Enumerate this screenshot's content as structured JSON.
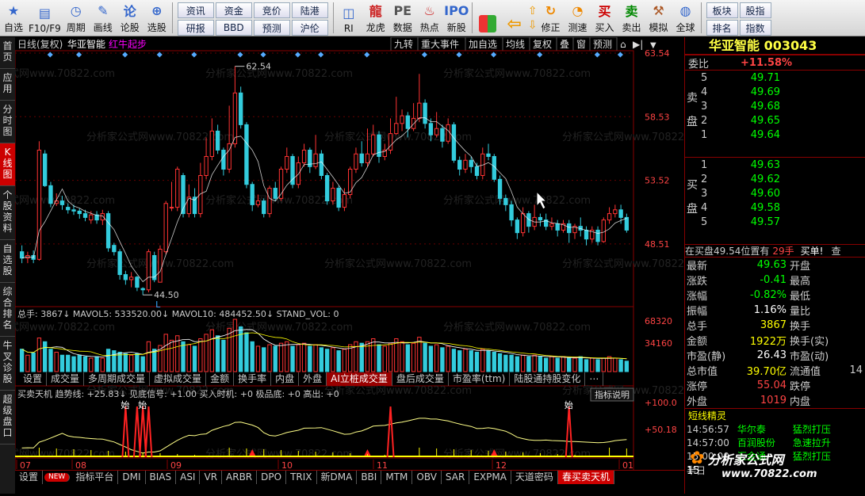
{
  "toolbar": {
    "buttons_left": [
      {
        "label": "自选",
        "icon": "star-icon"
      },
      {
        "label": "F10/F9",
        "icon": "f10-icon"
      },
      {
        "label": "周期",
        "icon": "clock-icon"
      },
      {
        "label": "画线",
        "icon": "pencil-icon"
      },
      {
        "label": "论股",
        "icon": "chat-icon"
      },
      {
        "label": "选股",
        "icon": "chart-select-icon"
      }
    ],
    "grid_buttons": [
      "资讯",
      "资金",
      "竞价",
      "陆港",
      "研报",
      "BBD",
      "预测",
      "沪伦"
    ],
    "buttons_mid": [
      {
        "label": "RI",
        "icon": "ri-icon"
      },
      {
        "label": "龙虎",
        "icon": "dragon-icon"
      },
      {
        "label": "数据",
        "icon": "pe-icon"
      },
      {
        "label": "热点",
        "icon": "hot-icon"
      },
      {
        "label": "新股",
        "icon": "ipo-icon"
      }
    ],
    "buttons_right": [
      {
        "label": "修正",
        "icon": "refresh-icon"
      },
      {
        "label": "测速",
        "icon": "speed-icon"
      },
      {
        "label": "买入",
        "icon": "buy-icon"
      },
      {
        "label": "卖出",
        "icon": "sell-icon"
      },
      {
        "label": "模拟",
        "icon": "hammer-icon"
      },
      {
        "label": "全球",
        "icon": "globe-icon"
      }
    ],
    "grid2_buttons": [
      "板块",
      "股指",
      "排名",
      "指数"
    ]
  },
  "left_tabs": [
    "首页",
    "应用",
    "分时图",
    "K线图",
    "个股资料",
    "自选股",
    "综合排名",
    "牛叉诊股",
    "超级盘口"
  ],
  "left_tabs_active": 3,
  "chart_header": {
    "period": "日线(复权)",
    "stock": "华亚智能",
    "signal": "红牛起步"
  },
  "chart_controls": [
    "九转",
    "重大事件",
    "加自选",
    "均线",
    "复权",
    "叠",
    "窗",
    "预测"
  ],
  "chart_data": {
    "type": "candlestick",
    "y_ticks": [
      "63.54",
      "58.53",
      "53.52",
      "48.51"
    ],
    "annotations": [
      "62.54",
      "44.50"
    ],
    "x_labels": [
      "07",
      "08",
      "09",
      "10",
      "11",
      "12",
      "01"
    ],
    "volume_labels": [
      "68320",
      "34160"
    ],
    "volume_title": "总手: 3867↓ MAVOL5: 533520.00↓ MAVOL10: 484452.50↓ STAND_VOL: 0",
    "indicator_title": "买卖天机 趋势线: +25.83↓ 见底信号: +1.00 买入时机: +0 极品底: +0 高出: +0",
    "indicator_ticks": [
      "+100.0",
      "+50.18"
    ],
    "indicator_button": "指标说明",
    "signal_text": "始",
    "candles": [
      [
        47.9,
        47.4,
        48.4,
        47.0
      ],
      [
        47.4,
        47.6,
        47.9,
        47.0
      ],
      [
        47.6,
        47.3,
        48.0,
        47.0
      ],
      [
        47.3,
        55.9,
        56.6,
        47.2
      ],
      [
        55.6,
        53.1,
        55.9,
        53.0
      ],
      [
        53.1,
        51.7,
        53.4,
        51.4
      ],
      [
        51.7,
        51.9,
        52.5,
        51.5
      ],
      [
        51.9,
        51.6,
        52.3,
        51.2
      ],
      [
        51.4,
        51.2,
        51.7,
        50.9
      ],
      [
        51.2,
        51.1,
        51.6,
        50.8
      ],
      [
        51.1,
        50.9,
        51.3,
        50.5
      ],
      [
        50.9,
        50.6,
        51.2,
        50.3
      ],
      [
        50.4,
        50.8,
        51.1,
        50.1
      ],
      [
        50.8,
        50.4,
        51.1,
        50.1
      ],
      [
        50.4,
        50.9,
        51.2,
        50.0
      ],
      [
        50.9,
        48.2,
        51.1,
        47.9
      ],
      [
        48.4,
        47.9,
        48.6,
        47.6
      ],
      [
        47.9,
        46.1,
        48.1,
        45.7
      ],
      [
        46.1,
        45.7,
        46.4,
        45.3
      ],
      [
        45.7,
        45.9,
        46.3,
        45.1
      ],
      [
        45.9,
        45.1,
        46.0,
        44.8
      ],
      [
        45.0,
        44.9,
        45.1,
        44.5
      ],
      [
        44.9,
        47.9,
        48.1,
        44.7
      ],
      [
        47.6,
        45.7,
        47.9,
        45.5
      ],
      [
        45.5,
        48.1,
        48.4,
        45.5
      ],
      [
        47.9,
        51.7,
        51.9,
        47.7
      ],
      [
        51.4,
        51.4,
        53.4,
        51.1
      ],
      [
        51.4,
        54.4,
        54.6,
        51.1
      ],
      [
        53.9,
        50.9,
        54.1,
        50.6
      ],
      [
        50.9,
        52.2,
        53.2,
        50.6
      ],
      [
        52.2,
        50.9,
        52.9,
        50.6
      ],
      [
        50.9,
        53.9,
        54.9,
        50.6
      ],
      [
        53.9,
        55.4,
        56.9,
        53.6
      ],
      [
        55.4,
        57.4,
        58.4,
        55.1
      ],
      [
        57.4,
        55.9,
        57.9,
        55.6
      ],
      [
        55.9,
        54.4,
        56.1,
        53.9
      ],
      [
        54.4,
        56.4,
        59.4,
        54.1
      ],
      [
        56.4,
        60.4,
        62.5,
        56.1
      ],
      [
        60.4,
        57.9,
        60.9,
        57.6
      ],
      [
        57.9,
        53.2,
        58.1,
        52.9
      ],
      [
        53.2,
        51.6,
        53.4,
        51.1
      ],
      [
        51.6,
        51.9,
        52.4,
        51.4
      ],
      [
        51.9,
        50.9,
        52.1,
        50.6
      ],
      [
        50.9,
        52.9,
        53.1,
        50.6
      ],
      [
        52.9,
        52.1,
        53.4,
        51.9
      ],
      [
        52.1,
        54.4,
        54.6,
        51.9
      ],
      [
        54.4,
        55.4,
        56.1,
        54.1
      ],
      [
        55.4,
        53.2,
        55.6,
        52.9
      ],
      [
        53.2,
        54.9,
        55.4,
        52.9
      ],
      [
        54.9,
        55.9,
        56.4,
        54.6
      ],
      [
        55.9,
        54.6,
        56.1,
        54.1
      ],
      [
        54.6,
        55.6,
        57.1,
        54.4
      ],
      [
        55.6,
        53.9,
        55.9,
        53.6
      ],
      [
        53.9,
        51.9,
        54.1,
        51.6
      ],
      [
        51.9,
        52.9,
        53.4,
        51.6
      ],
      [
        52.9,
        51.4,
        53.1,
        51.1
      ],
      [
        51.4,
        52.4,
        52.9,
        51.1
      ],
      [
        52.4,
        54.4,
        54.6,
        52.1
      ],
      [
        54.4,
        55.6,
        56.1,
        54.1
      ],
      [
        55.6,
        54.9,
        56.6,
        54.6
      ],
      [
        54.9,
        55.6,
        57.6,
        54.6
      ],
      [
        55.6,
        57.1,
        57.9,
        55.4
      ],
      [
        57.1,
        55.4,
        57.4,
        54.9
      ],
      [
        55.4,
        55.9,
        56.4,
        55.1
      ],
      [
        55.9,
        57.2,
        58.4,
        55.6
      ],
      [
        57.2,
        58.0,
        60.1,
        57.1
      ],
      [
        58.0,
        58.6,
        59.1,
        57.4
      ],
      [
        58.6,
        57.6,
        58.9,
        56.9
      ],
      [
        57.6,
        58.4,
        59.6,
        57.4
      ],
      [
        58.4,
        59.6,
        61.9,
        58.1
      ],
      [
        59.6,
        58.0,
        59.9,
        57.6
      ],
      [
        58.0,
        57.1,
        58.4,
        56.6
      ],
      [
        57.1,
        57.6,
        58.9,
        56.9
      ],
      [
        57.6,
        56.6,
        57.9,
        56.1
      ],
      [
        56.6,
        57.9,
        58.4,
        56.4
      ],
      [
        57.9,
        55.1,
        58.1,
        54.9
      ],
      [
        55.1,
        54.4,
        55.4,
        53.9
      ],
      [
        54.4,
        55.1,
        55.6,
        54.1
      ],
      [
        55.1,
        54.6,
        55.4,
        54.1
      ],
      [
        54.6,
        53.9,
        54.9,
        53.6
      ],
      [
        53.9,
        55.6,
        56.1,
        53.6
      ],
      [
        55.6,
        55.4,
        56.4,
        55.1
      ],
      [
        55.4,
        53.6,
        55.6,
        53.4
      ],
      [
        53.6,
        52.1,
        53.9,
        51.6
      ],
      [
        52.1,
        51.6,
        52.4,
        51.1
      ],
      [
        51.6,
        50.4,
        51.9,
        49.9
      ],
      [
        50.4,
        49.4,
        50.6,
        48.9
      ],
      [
        49.4,
        50.9,
        51.4,
        49.1
      ],
      [
        50.9,
        49.9,
        51.1,
        49.4
      ],
      [
        49.9,
        50.6,
        51.6,
        49.6
      ],
      [
        50.6,
        50.4,
        50.9,
        49.9
      ],
      [
        50.4,
        49.9,
        50.9,
        49.6
      ],
      [
        49.9,
        50.1,
        50.6,
        49.6
      ],
      [
        50.1,
        49.6,
        50.4,
        49.1
      ],
      [
        49.6,
        50.1,
        50.4,
        49.4
      ],
      [
        50.1,
        49.4,
        50.4,
        48.6
      ],
      [
        49.4,
        49.9,
        50.1,
        48.9
      ],
      [
        49.9,
        49.6,
        50.6,
        49.1
      ],
      [
        49.6,
        48.9,
        49.9,
        48.4
      ],
      [
        48.9,
        49.6,
        49.9,
        48.6
      ],
      [
        49.6,
        48.7,
        49.9,
        48.4
      ],
      [
        48.7,
        50.4,
        50.6,
        48.6
      ],
      [
        50.4,
        50.9,
        51.4,
        50.1
      ],
      [
        50.9,
        51.2,
        51.6,
        50.6
      ],
      [
        51.2,
        50.6,
        51.6,
        50.1
      ],
      [
        50.6,
        49.6,
        50.9,
        49.4
      ]
    ],
    "volumes": [
      30,
      22,
      25,
      45,
      40,
      30,
      26,
      22,
      22,
      20,
      22,
      20,
      18,
      20,
      18,
      30,
      28,
      26,
      24,
      22,
      24,
      20,
      40,
      30,
      35,
      50,
      42,
      48,
      40,
      36,
      34,
      44,
      50,
      56,
      48,
      42,
      58,
      70,
      60,
      52,
      40,
      34,
      32,
      36,
      34,
      38,
      40,
      34,
      36,
      38,
      34,
      36,
      32,
      30,
      32,
      28,
      30,
      36,
      40,
      38,
      40,
      44,
      36,
      34,
      38,
      44,
      40,
      36,
      38,
      46,
      38,
      34,
      36,
      32,
      34,
      30,
      28,
      30,
      28,
      26,
      30,
      28,
      26,
      24,
      22,
      22,
      20,
      22,
      20,
      22,
      20,
      18,
      20,
      18,
      20,
      18,
      18,
      20,
      16,
      18,
      16,
      18,
      20,
      18,
      16,
      14
    ]
  },
  "mid_tabs": [
    "设置",
    "成交量",
    "多周期成交量",
    "虚拟成交量",
    "金额",
    "换手率",
    "内盘",
    "外盘",
    "AI立桩成交量",
    "盘后成交量",
    "市盈率(ttm)",
    "陆股通持股变化",
    "⋯"
  ],
  "mid_tabs_active": 8,
  "bottom_tabs": [
    "设置",
    "NEW",
    "指标平台",
    "DMI",
    "BIAS",
    "ASI",
    "VR",
    "ARBR",
    "DPO",
    "TRIX",
    "新DMA",
    "BBI",
    "MTM",
    "OBV",
    "SAR",
    "EXPMA",
    "天道密码",
    "春买卖天机"
  ],
  "bottom_tabs_active": 17,
  "right": {
    "title": "华亚智能 003043",
    "weibi_label": "委比",
    "weibi_value": "+11.58%",
    "sell_label": "卖盘",
    "buy_label": "买盘",
    "sells": [
      {
        "n": "5",
        "p": "49.71"
      },
      {
        "n": "4",
        "p": "49.69"
      },
      {
        "n": "3",
        "p": "49.68"
      },
      {
        "n": "2",
        "p": "49.65"
      },
      {
        "n": "1",
        "p": "49.64"
      }
    ],
    "buys": [
      {
        "n": "1",
        "p": "49.63"
      },
      {
        "n": "2",
        "p": "49.62"
      },
      {
        "n": "3",
        "p": "49.60"
      },
      {
        "n": "4",
        "p": "49.58"
      },
      {
        "n": "5",
        "p": "49.57"
      }
    ],
    "notice": "在买盘49.54位置有",
    "notice_qty": "29手",
    "notice_action": "买单!",
    "notice_more": "查",
    "quotes": [
      {
        "k": "最新",
        "v": "49.63",
        "c": "#0f0",
        "k2": "开盘",
        "v2": ""
      },
      {
        "k": "涨跌",
        "v": "-0.41",
        "c": "#0f0",
        "k2": "最高",
        "v2": ""
      },
      {
        "k": "涨幅",
        "v": "-0.82%",
        "c": "#0f0",
        "k2": "最低",
        "v2": ""
      },
      {
        "k": "振幅",
        "v": "1.16%",
        "c": "#fff",
        "k2": "量比",
        "v2": ""
      },
      {
        "k": "总手",
        "v": "3867",
        "c": "#ff0",
        "k2": "换手",
        "v2": ""
      },
      {
        "k": "金额",
        "v": "1922万",
        "c": "#ff0",
        "k2": "换手(实)",
        "v2": ""
      },
      {
        "k": "市盈(静)",
        "v": "26.43",
        "c": "#fff",
        "k2": "市盈(动)",
        "v2": ""
      },
      {
        "k": "总市值",
        "v": "39.70亿",
        "c": "#ff0",
        "k2": "流通值",
        "v2": "14"
      },
      {
        "k": "涨停",
        "v": "55.04",
        "c": "#f44",
        "k2": "跌停",
        "v2": ""
      },
      {
        "k": "外盘",
        "v": "1019",
        "c": "#f44",
        "k2": "内盘",
        "v2": ""
      }
    ],
    "elves_title": "短线精灵",
    "elves": [
      {
        "t": "14:56:57",
        "s": "华尔泰",
        "e": "猛烈打压"
      },
      {
        "t": "14:57:00",
        "s": "百润股份",
        "e": "急速拉升"
      },
      {
        "t": "15:00:00",
        "s": "汇金通",
        "e": "猛烈打压"
      }
    ],
    "footer_left": "半日",
    "footer_num": "15"
  },
  "logo": {
    "text": "分析家公式网",
    "url": "www.70822.com"
  },
  "watermark": "分析家公式网www.70822.com"
}
